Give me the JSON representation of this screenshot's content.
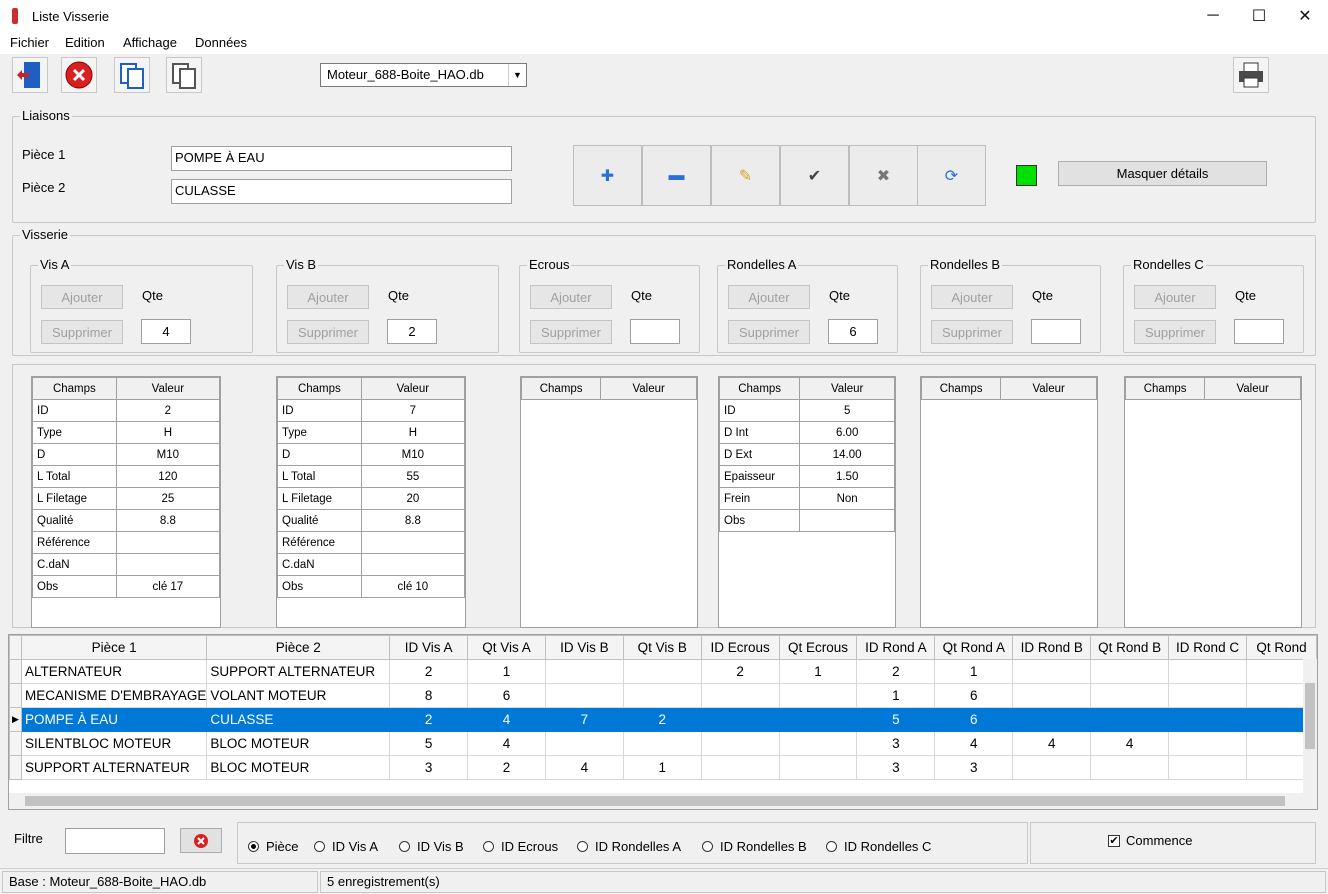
{
  "window": {
    "title": "Liste Visserie",
    "minimize": "─",
    "maximize": "☐",
    "close": "✕"
  },
  "menu": [
    "Fichier",
    "Edition",
    "Affichage",
    "Données"
  ],
  "toolbar": {
    "db_select": "Moteur_688-Boite_HAO.db"
  },
  "liaisons": {
    "legend": "Liaisons",
    "piece1_label": "Pièce 1",
    "piece1_value": "POMPE À EAU",
    "piece2_label": "Pièce 2",
    "piece2_value": "CULASSE",
    "masquer_label": "Masquer détails",
    "status_color": "#00e000",
    "action_icons": [
      "plus-icon",
      "minus-icon",
      "pencil-icon",
      "check-icon",
      "cross-icon",
      "refresh-icon"
    ]
  },
  "visserie": {
    "legend": "Visserie",
    "groups": [
      {
        "title": "Vis A",
        "add": "Ajouter",
        "remove": "Supprimer",
        "qte_label": "Qte",
        "qte": "4"
      },
      {
        "title": "Vis B",
        "add": "Ajouter",
        "remove": "Supprimer",
        "qte_label": "Qte",
        "qte": "2"
      },
      {
        "title": "Ecrous",
        "add": "Ajouter",
        "remove": "Supprimer",
        "qte_label": "Qte",
        "qte": ""
      },
      {
        "title": "Rondelles A",
        "add": "Ajouter",
        "remove": "Supprimer",
        "qte_label": "Qte",
        "qte": "6"
      },
      {
        "title": "Rondelles B",
        "add": "Ajouter",
        "remove": "Supprimer",
        "qte_label": "Qte",
        "qte": ""
      },
      {
        "title": "Rondelles C",
        "add": "Ajouter",
        "remove": "Supprimer",
        "qte_label": "Qte",
        "qte": ""
      }
    ]
  },
  "details": {
    "headers": [
      "Champs",
      "Valeur"
    ],
    "panels": [
      {
        "rows": [
          [
            "ID",
            "2"
          ],
          [
            "Type",
            "H"
          ],
          [
            "D",
            "M10"
          ],
          [
            "L Total",
            "120"
          ],
          [
            "L Filetage",
            "25"
          ],
          [
            "Qualité",
            "8.8"
          ],
          [
            "Référence",
            ""
          ],
          [
            "C.daN",
            ""
          ],
          [
            "Obs",
            "clé 17"
          ]
        ]
      },
      {
        "rows": [
          [
            "ID",
            "7"
          ],
          [
            "Type",
            "H"
          ],
          [
            "D",
            "M10"
          ],
          [
            "L Total",
            "55"
          ],
          [
            "L Filetage",
            "20"
          ],
          [
            "Qualité",
            "8.8"
          ],
          [
            "Référence",
            ""
          ],
          [
            "C.daN",
            ""
          ],
          [
            "Obs",
            "clé 10"
          ]
        ]
      },
      {
        "rows": []
      },
      {
        "rows": [
          [
            "ID",
            "5"
          ],
          [
            "D Int",
            "6.00"
          ],
          [
            "D Ext",
            "14.00"
          ],
          [
            "Epaisseur",
            "1.50"
          ],
          [
            "Frein",
            "Non"
          ],
          [
            "Obs",
            ""
          ]
        ]
      },
      {
        "rows": []
      },
      {
        "rows": []
      }
    ]
  },
  "grid": {
    "columns": [
      "Pièce 1",
      "Pièce 2",
      "ID Vis A",
      "Qt Vis A",
      "ID Vis B",
      "Qt Vis B",
      "ID Ecrous",
      "Qt Ecrous",
      "ID Rond A",
      "Qt Rond A",
      "ID Rond B",
      "Qt Rond B",
      "ID Rond C",
      "Qt Rond"
    ],
    "rows": [
      [
        "ALTERNATEUR",
        "SUPPORT ALTERNATEUR",
        "2",
        "1",
        "",
        "",
        "2",
        "1",
        "2",
        "1",
        "",
        "",
        "",
        ""
      ],
      [
        "MECANISME D'EMBRAYAGE",
        "VOLANT MOTEUR",
        "8",
        "6",
        "",
        "",
        "",
        "",
        "1",
        "6",
        "",
        "",
        "",
        ""
      ],
      [
        "POMPE À EAU",
        "CULASSE",
        "2",
        "4",
        "7",
        "2",
        "",
        "",
        "5",
        "6",
        "",
        "",
        "",
        ""
      ],
      [
        "SILENTBLOC MOTEUR",
        "BLOC MOTEUR",
        "5",
        "4",
        "",
        "",
        "",
        "",
        "3",
        "4",
        "4",
        "4",
        "",
        ""
      ],
      [
        "SUPPORT ALTERNATEUR",
        "BLOC MOTEUR",
        "3",
        "2",
        "4",
        "1",
        "",
        "",
        "3",
        "3",
        "",
        "",
        "",
        ""
      ]
    ],
    "selected_row": 2
  },
  "filter": {
    "label": "Filtre",
    "value": "",
    "options": [
      "Pièce",
      "ID Vis A",
      "ID Vis B",
      "ID Ecrous",
      "ID Rondelles A",
      "ID Rondelles B",
      "ID Rondelles C"
    ],
    "selected": "Pièce",
    "commence_label": "Commence",
    "commence_checked": true
  },
  "status": {
    "base": "Base : Moteur_688-Boite_HAO.db",
    "count": "5 enregistrement(s)"
  }
}
